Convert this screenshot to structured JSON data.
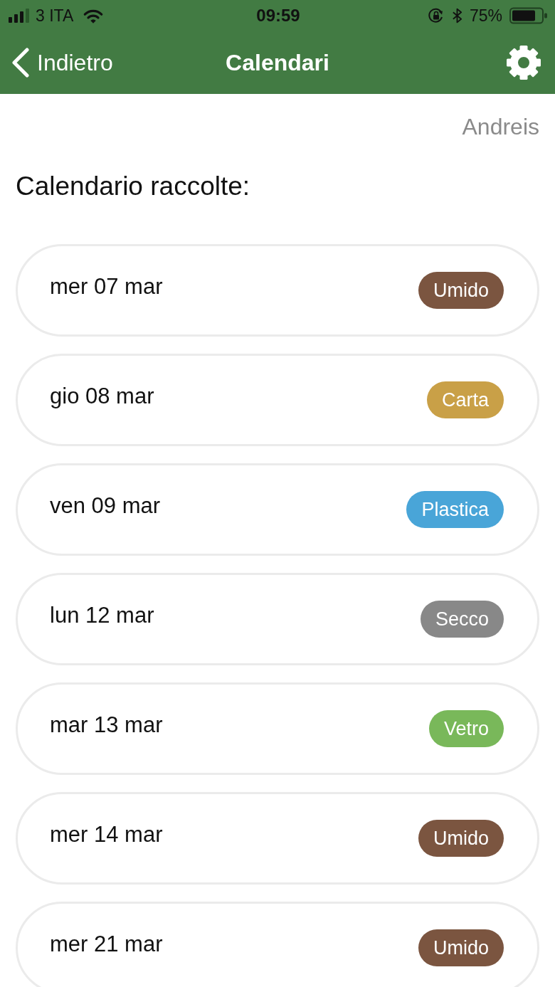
{
  "status_bar": {
    "carrier": "3 ITA",
    "time": "09:59",
    "battery": "75%"
  },
  "nav_bar": {
    "back_label": "Indietro",
    "title": "Calendari"
  },
  "user": "Andreis",
  "heading": "Calendario raccolte:",
  "collections": [
    {
      "date": "mer 07 mar",
      "type": "Umido",
      "color": "#7b5540"
    },
    {
      "date": "gio 08 mar",
      "type": "Carta",
      "color": "#c9a047"
    },
    {
      "date": "ven 09 mar",
      "type": "Plastica",
      "color": "#49a5d8"
    },
    {
      "date": "lun 12 mar",
      "type": "Secco",
      "color": "#888888"
    },
    {
      "date": "mar 13 mar",
      "type": "Vetro",
      "color": "#79b85a"
    },
    {
      "date": "mer 14 mar",
      "type": "Umido",
      "color": "#7b5540"
    },
    {
      "date": "mer 21 mar",
      "type": "Umido",
      "color": "#7b5540"
    }
  ]
}
